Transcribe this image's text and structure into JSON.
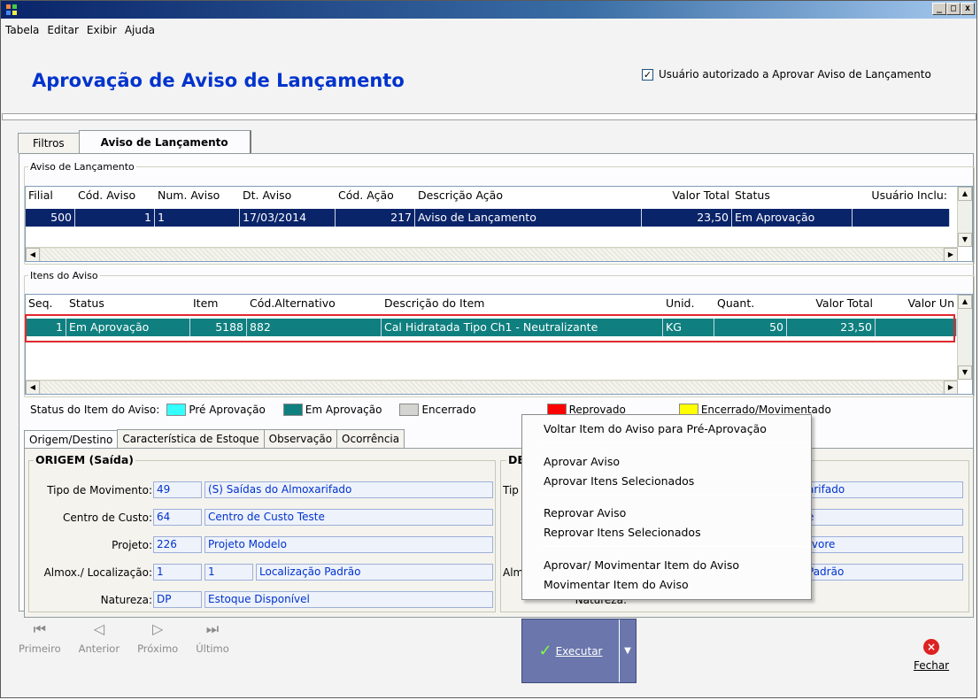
{
  "window": {
    "controls": [
      "_",
      "□",
      "x"
    ]
  },
  "menu": [
    "Tabela",
    "Editar",
    "Exibir",
    "Ajuda"
  ],
  "page_title": "Aprovação de Aviso de Lançamento",
  "auth": {
    "label": "Usuário autorizado a Aprovar Aviso de Lançamento",
    "checked": "✓"
  },
  "tabs": [
    "Filtros",
    "Aviso de Lançamento"
  ],
  "aviso": {
    "legend": "Aviso de Lançamento",
    "headers": [
      "Filial",
      "Cód. Aviso",
      "Num. Aviso",
      "Dt. Aviso",
      "Cód. Ação",
      "Descrição Ação",
      "Valor Total",
      "Status",
      "Usuário Inclu:"
    ],
    "rows": [
      [
        "500",
        "1",
        "1",
        "17/03/2014",
        "217",
        "Aviso de Lançamento",
        "23,50",
        "Em Aprovação",
        ""
      ]
    ]
  },
  "itens": {
    "legend": "Itens do Aviso",
    "headers": [
      "Seq.",
      "Status",
      "Item",
      "Cód.Alternativo",
      "Descrição do Item",
      "Unid.",
      "Quant.",
      "Valor Total",
      "Valor Un"
    ],
    "rows": [
      [
        "1",
        "Em Aprovação",
        "5188",
        "882",
        "Cal Hidratada Tipo Ch1 - Neutralizante",
        "KG",
        "50",
        "23,50",
        ""
      ]
    ]
  },
  "status_legend": {
    "label": "Status do Item do Aviso:",
    "items": [
      {
        "name": "Pré Aprovação",
        "color": "#33ffff"
      },
      {
        "name": "Em Aprovação",
        "color": "#0f7f7f"
      },
      {
        "name": "Encerrado",
        "color": "#d4d4d0"
      },
      {
        "name": "Reprovado",
        "color": "#ff0000"
      },
      {
        "name": "Encerrado/Movimentado",
        "color": "#ffff00"
      }
    ]
  },
  "subtabs": [
    "Origem/Destino",
    "Característica de Estoque",
    "Observação",
    "Ocorrência"
  ],
  "origem": {
    "title": "ORIGEM (Saída)",
    "tipo_label": "Tipo de Movimento:",
    "tipo_code": "49",
    "tipo_desc": "(S) Saídas do Almoxarifado",
    "centro_label": "Centro de Custo:",
    "centro_code": "64",
    "centro_desc": "Centro de Custo Teste",
    "projeto_label": "Projeto:",
    "projeto_code": "226",
    "projeto_desc": "Projeto Modelo",
    "almox_label": "Almox./ Localização:",
    "almox_code": "1",
    "local_code": "1",
    "local_desc": "Localização Padrão",
    "natureza_label": "Natureza:",
    "natureza_code": "DP",
    "natureza_desc": "Estoque Disponível"
  },
  "destino": {
    "title": "DE",
    "tipo_label": "Tip",
    "tipo_desc": "arifado",
    "centro_desc": "e",
    "projeto_desc": "rvore",
    "almox_label": "Alm",
    "local_desc": "Padrão",
    "natureza_label": "Natureza:"
  },
  "context_menu": [
    "Voltar Item do Aviso para Pré-Aprovação",
    "Aprovar Aviso",
    "Aprovar Itens Selecionados",
    "Reprovar Aviso",
    "Reprovar Itens Selecionados",
    "Aprovar/ Movimentar Item do Aviso",
    "Movimentar Item do Aviso"
  ],
  "nav": [
    "Primeiro",
    "Anterior",
    "Próximo",
    "Último"
  ],
  "executar": "Executar",
  "fechar": "Fechar"
}
